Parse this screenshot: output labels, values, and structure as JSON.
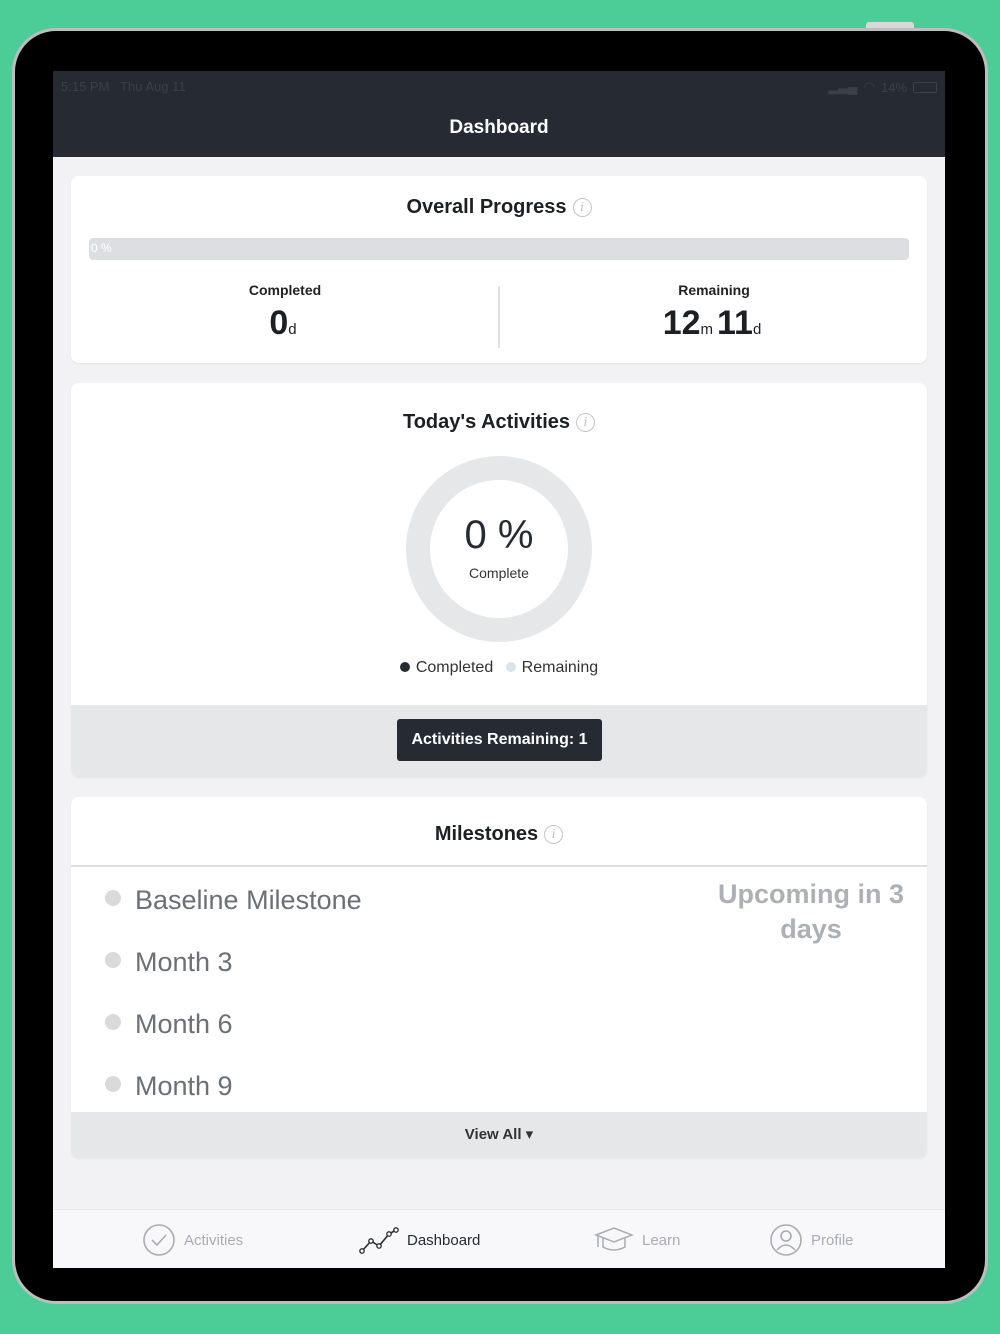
{
  "status_bar": {
    "time": "5:15 PM",
    "date": "Thu Aug 11",
    "battery": "14%"
  },
  "header": {
    "title": "Dashboard"
  },
  "overall_progress": {
    "title": "Overall Progress",
    "info_icon": "i",
    "progress_text": "0 %",
    "progress_fraction": 0,
    "completed": {
      "label": "Completed",
      "value": "0",
      "unit": "d"
    },
    "remaining": {
      "label": "Remaining",
      "months": "12",
      "month_unit": "m",
      "days": "11",
      "day_unit": "d"
    }
  },
  "todays_activities": {
    "title": "Today's Activities",
    "info_icon": "i",
    "percent_text": "0 %",
    "percent_value": 0,
    "complete_label": "Complete",
    "legend": {
      "completed": "Completed",
      "remaining": "Remaining"
    },
    "remaining_button": "Activities Remaining: 1"
  },
  "milestones": {
    "title": "Milestones",
    "info_icon": "i",
    "items": [
      {
        "label": "Baseline Milestone"
      },
      {
        "label": "Month 3"
      },
      {
        "label": "Month 6"
      },
      {
        "label": "Month 9"
      }
    ],
    "upcoming": "Upcoming in 3 days",
    "view_all": "View All ▾"
  },
  "tabs": [
    {
      "label": "Activities",
      "icon": "check-circle-icon",
      "active": false
    },
    {
      "label": "Dashboard",
      "icon": "line-chart-icon",
      "active": true
    },
    {
      "label": "Learn",
      "icon": "graduation-cap-icon",
      "active": false
    },
    {
      "label": "Profile",
      "icon": "user-circle-icon",
      "active": false
    }
  ],
  "colors": {
    "background": "#4ccd98",
    "header": "#262b33",
    "completed_dot": "#262b33",
    "remaining_dot": "#dde3ea"
  }
}
